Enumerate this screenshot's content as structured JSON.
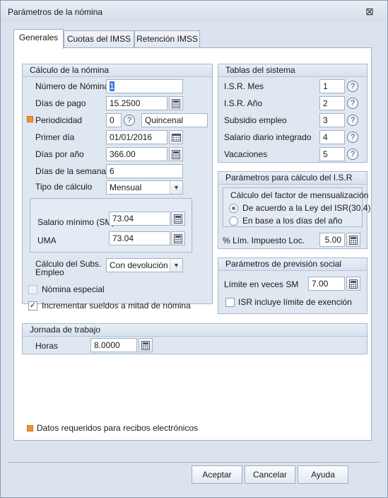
{
  "window": {
    "title": "Parámetros de la nómina",
    "close_glyph": "⊠"
  },
  "tabs": [
    {
      "label": "Generales",
      "active": true
    },
    {
      "label": "Cuotas del IMSS",
      "active": false
    },
    {
      "label": "Retención IMSS",
      "active": false
    }
  ],
  "calculo": {
    "title": "Cálculo de la nómina",
    "numero_label": "Número de Nómina",
    "numero_value": "1",
    "dias_pago_label": "Días de pago",
    "dias_pago_value": "15.2500",
    "periodicidad_label": "Periodicidad",
    "periodicidad_value": "0",
    "periodicidad_name": "Quincenal",
    "primer_dia_label": "Primer día",
    "primer_dia_value": "01/01/2016",
    "dias_anio_label": "Días por año",
    "dias_anio_value": "366.00",
    "dias_semana_label": "Días de la semana",
    "dias_semana_value": "6",
    "tipo_calculo_label": "Tipo de cálculo",
    "tipo_calculo_value": "Mensual",
    "salario_minimo_label": "Salario mínimo (SM)",
    "salario_minimo_value": "73.04",
    "uma_label": "UMA",
    "uma_value": "73.04",
    "subs_empleo_label_1": "Cálculo del Subs.",
    "subs_empleo_label_2": "Empleo",
    "subs_empleo_value": "Con devolución",
    "nomina_especial_label": "Nómina especial",
    "nomina_especial_checked": false,
    "incrementar_label": "Incrementar sueldos a mitad de nómina",
    "incrementar_checked": true
  },
  "tablas": {
    "title": "Tablas del sistema",
    "rows": [
      {
        "label": "I.S.R. Mes",
        "value": "1"
      },
      {
        "label": "I.S.R. Año",
        "value": "2"
      },
      {
        "label": "Subsidio empleo",
        "value": "3"
      },
      {
        "label": "Salario diario integrado",
        "value": "4"
      },
      {
        "label": "Vacaciones",
        "value": "5"
      }
    ]
  },
  "isr": {
    "title": "Parámetros para cálculo del I.S.R",
    "factor_title": "Cálculo del factor de mensualización",
    "option_1": "De acuerdo a la Ley del ISR(30.4)",
    "option_2": "En base a los días del año",
    "selected_option": 1,
    "lim_label": "% Lím. Impuesto Loc.",
    "lim_value": "5.00"
  },
  "prevision": {
    "title": "Parámetros de previsión social",
    "limite_label": "Límite en veces SM",
    "limite_value": "7.00",
    "isr_incluye_label": "ISR incluye límite de exención",
    "isr_incluye_checked": false
  },
  "jornada": {
    "title": "Jornada de trabajo",
    "horas_label": "Horas",
    "horas_value": "8.0000"
  },
  "legend": {
    "text": "Datos requeridos para recibos electrónicos"
  },
  "buttons": {
    "accept": "Aceptar",
    "cancel": "Cancelar",
    "help": "Ayuda"
  },
  "colors": {
    "required_marker": "#e8962d",
    "group_bg": "#dfe7f1",
    "window_bg": "#dbe3ee"
  },
  "icons": {
    "calculator": "calculator-icon",
    "calendar": "calendar-icon",
    "help": "help-icon",
    "dropdown": "chevron-down-icon"
  }
}
